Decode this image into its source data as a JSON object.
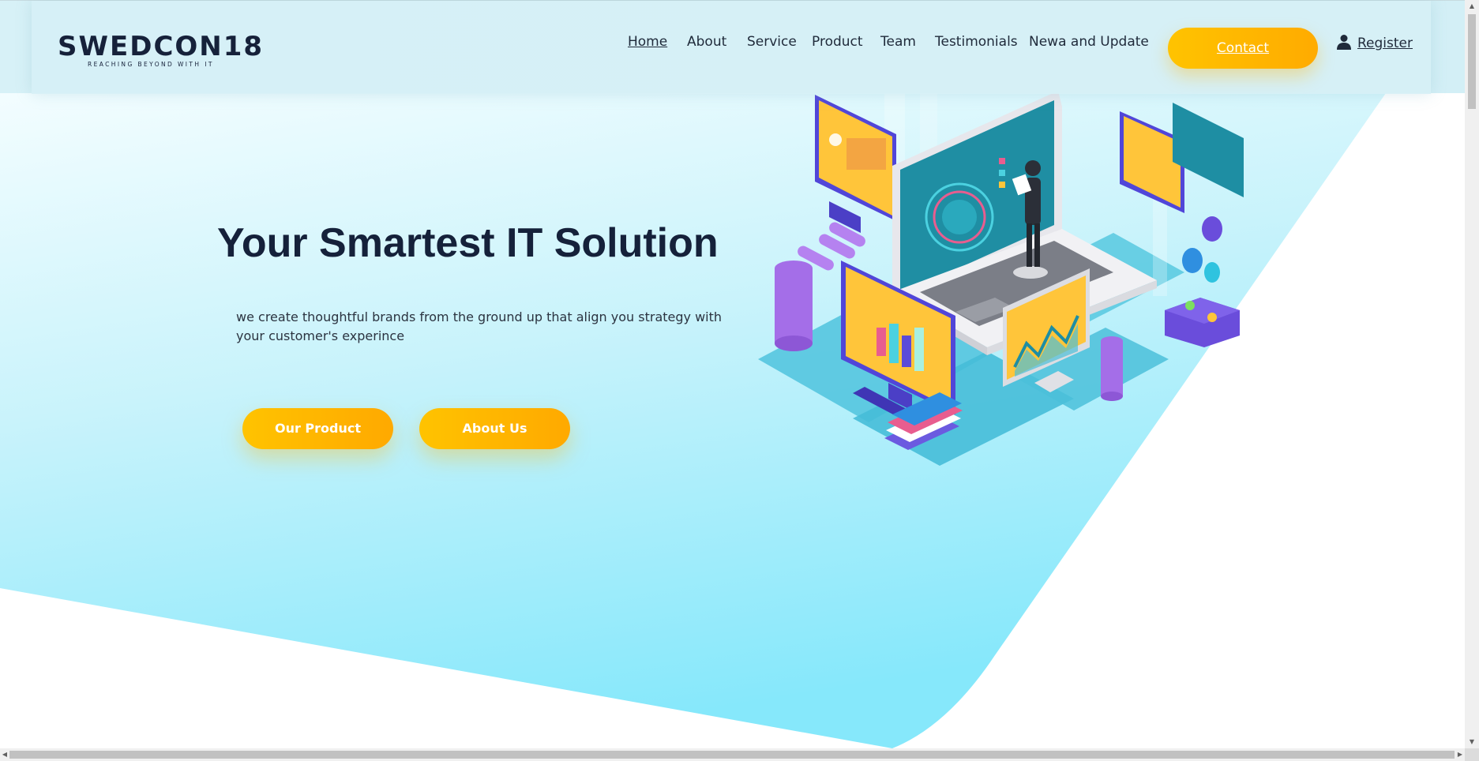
{
  "brand": {
    "name": "SWEDCON18",
    "tagline": "REACHING BEYOND WITH IT"
  },
  "nav": {
    "items": [
      {
        "label": "Home",
        "active": true
      },
      {
        "label": "About",
        "active": false
      },
      {
        "label": "Service",
        "active": false
      },
      {
        "label": "Product",
        "active": false
      },
      {
        "label": "Team",
        "active": false
      },
      {
        "label": "Testimonials",
        "active": false
      },
      {
        "label": "Newa and Update",
        "active": false
      }
    ],
    "contact_label": "Contact",
    "register_label": "Register"
  },
  "hero": {
    "title": "Your Smartest IT Solution",
    "subtitle": "we create thoughtful brands from the ground up that align you strategy with your customer's experince",
    "buttons": {
      "product_label": "Our Product",
      "about_label": "About Us"
    }
  },
  "colors": {
    "accent": "#ffb400",
    "hero_gradient_start": "#eafbff",
    "hero_gradient_end": "#7fe6fb",
    "header_bg": "#d6f0f6",
    "text_dark": "#15213a"
  },
  "icons": {
    "register": "user-icon",
    "illustration": "isometric-it-illustration"
  }
}
